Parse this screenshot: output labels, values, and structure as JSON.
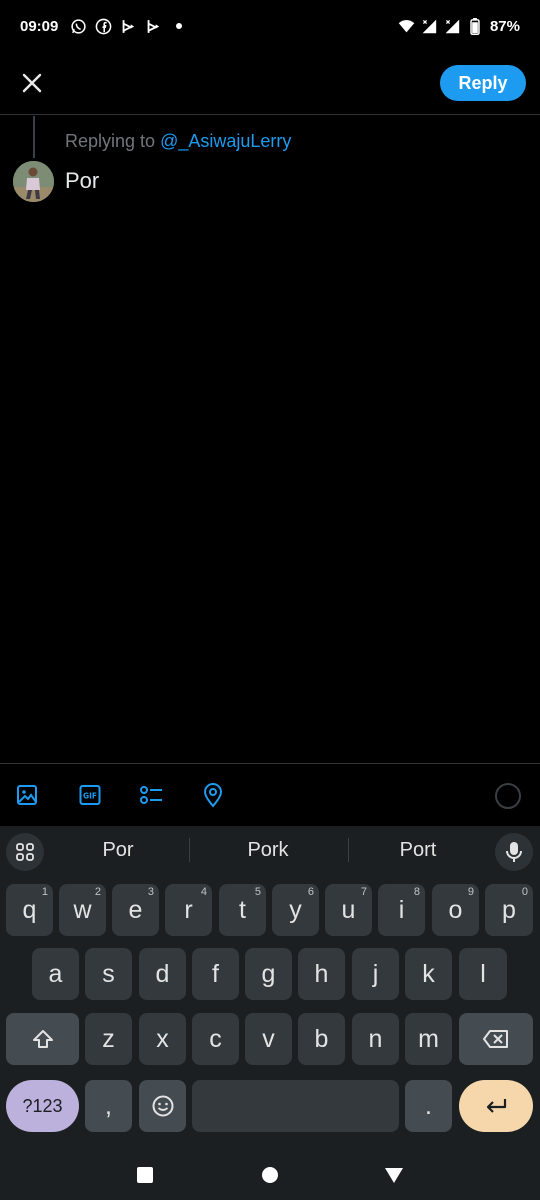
{
  "status_bar": {
    "time": "09:09",
    "battery": "87%",
    "left_icons": [
      "whatsapp-icon",
      "facebook-icon",
      "bluesky-app-icon",
      "bluesky-app-icon",
      "dot-icon"
    ],
    "right_icons": [
      "wifi-icon",
      "signal-icon",
      "signal-icon",
      "battery-icon"
    ]
  },
  "header": {
    "close_icon": "close-icon",
    "reply_label": "Reply",
    "accent": "#1d9bf0"
  },
  "compose": {
    "replying_prefix": "Replying to",
    "replying_handle": "@_AsiwajuLerry",
    "text": "Por",
    "avatar_icon": "user-avatar"
  },
  "toolbar": {
    "icons": [
      "image-icon",
      "gif-icon",
      "poll-icon",
      "location-icon",
      "character-count-ring"
    ]
  },
  "keyboard": {
    "suggestions": [
      "Por",
      "Pork",
      "Port"
    ],
    "row1": [
      {
        "k": "q",
        "h": "1"
      },
      {
        "k": "w",
        "h": "2"
      },
      {
        "k": "e",
        "h": "3"
      },
      {
        "k": "r",
        "h": "4"
      },
      {
        "k": "t",
        "h": "5"
      },
      {
        "k": "y",
        "h": "6"
      },
      {
        "k": "u",
        "h": "7"
      },
      {
        "k": "i",
        "h": "8"
      },
      {
        "k": "o",
        "h": "9"
      },
      {
        "k": "p",
        "h": "0"
      }
    ],
    "row2": [
      "a",
      "s",
      "d",
      "f",
      "g",
      "h",
      "j",
      "k",
      "l"
    ],
    "row3": [
      "z",
      "x",
      "c",
      "v",
      "b",
      "n",
      "m"
    ],
    "symbols_label": "?123",
    "comma_label": ",",
    "period_label": ".",
    "colors": {
      "symbols": "#bcb0dc",
      "enter": "#f5d7ab"
    }
  },
  "nav": {
    "icons": [
      "recents-icon",
      "home-icon",
      "back-icon"
    ]
  }
}
